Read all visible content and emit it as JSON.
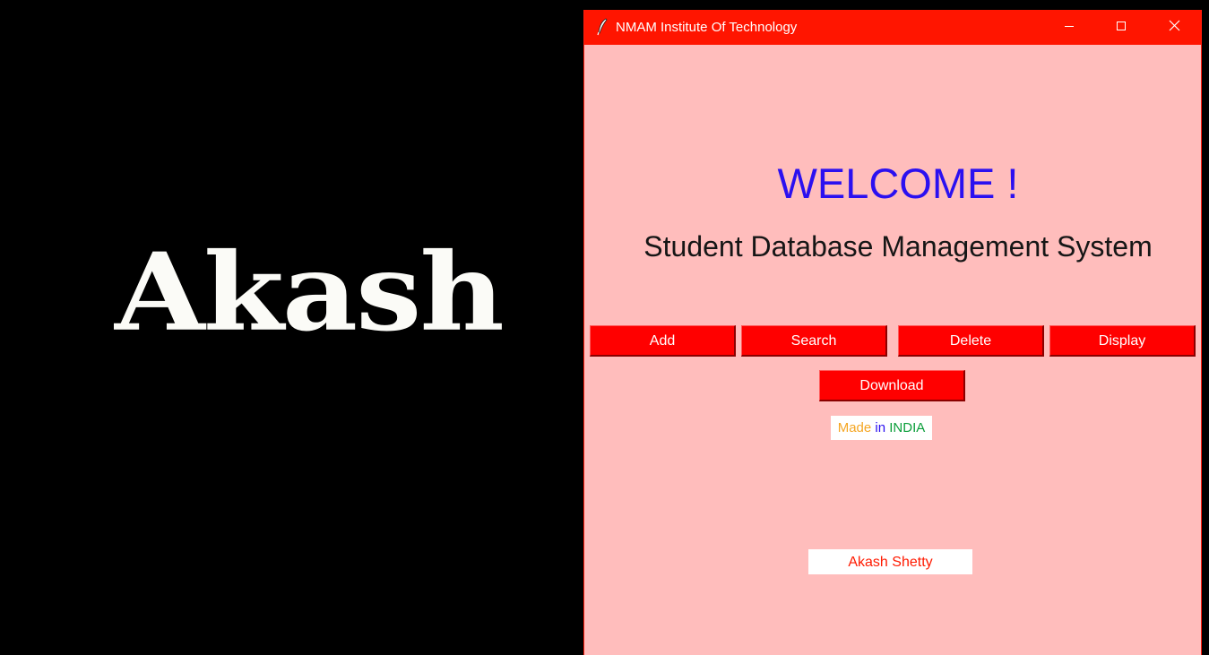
{
  "desktop": {
    "background_logo_text": "Akash",
    "background_color": "#000000",
    "logo_color": "#fbfbf7"
  },
  "window": {
    "title": "NMAM Institute Of Technology",
    "titlebar_color": "#ff1500",
    "body_color": "#ffbdbc",
    "icons": {
      "app": "feather-icon",
      "minimize": "minimize-icon",
      "maximize": "maximize-icon",
      "close": "close-icon"
    }
  },
  "main": {
    "welcome": "WELCOME !",
    "welcome_color": "#2b10f0",
    "subtitle": "Student Database Management System",
    "buttons": {
      "add": "Add",
      "search": "Search",
      "delete": "Delete",
      "display": "Display",
      "download": "Download"
    },
    "button_color": "#ff0000",
    "made_in": {
      "made": "Made",
      "made_color": "#f5a623",
      "in": "in",
      "in_color": "#2b10f0",
      "india": "INDIA",
      "india_color": "#0b9e3a"
    },
    "author": "Akash Shetty",
    "author_color": "#ff1a00"
  }
}
